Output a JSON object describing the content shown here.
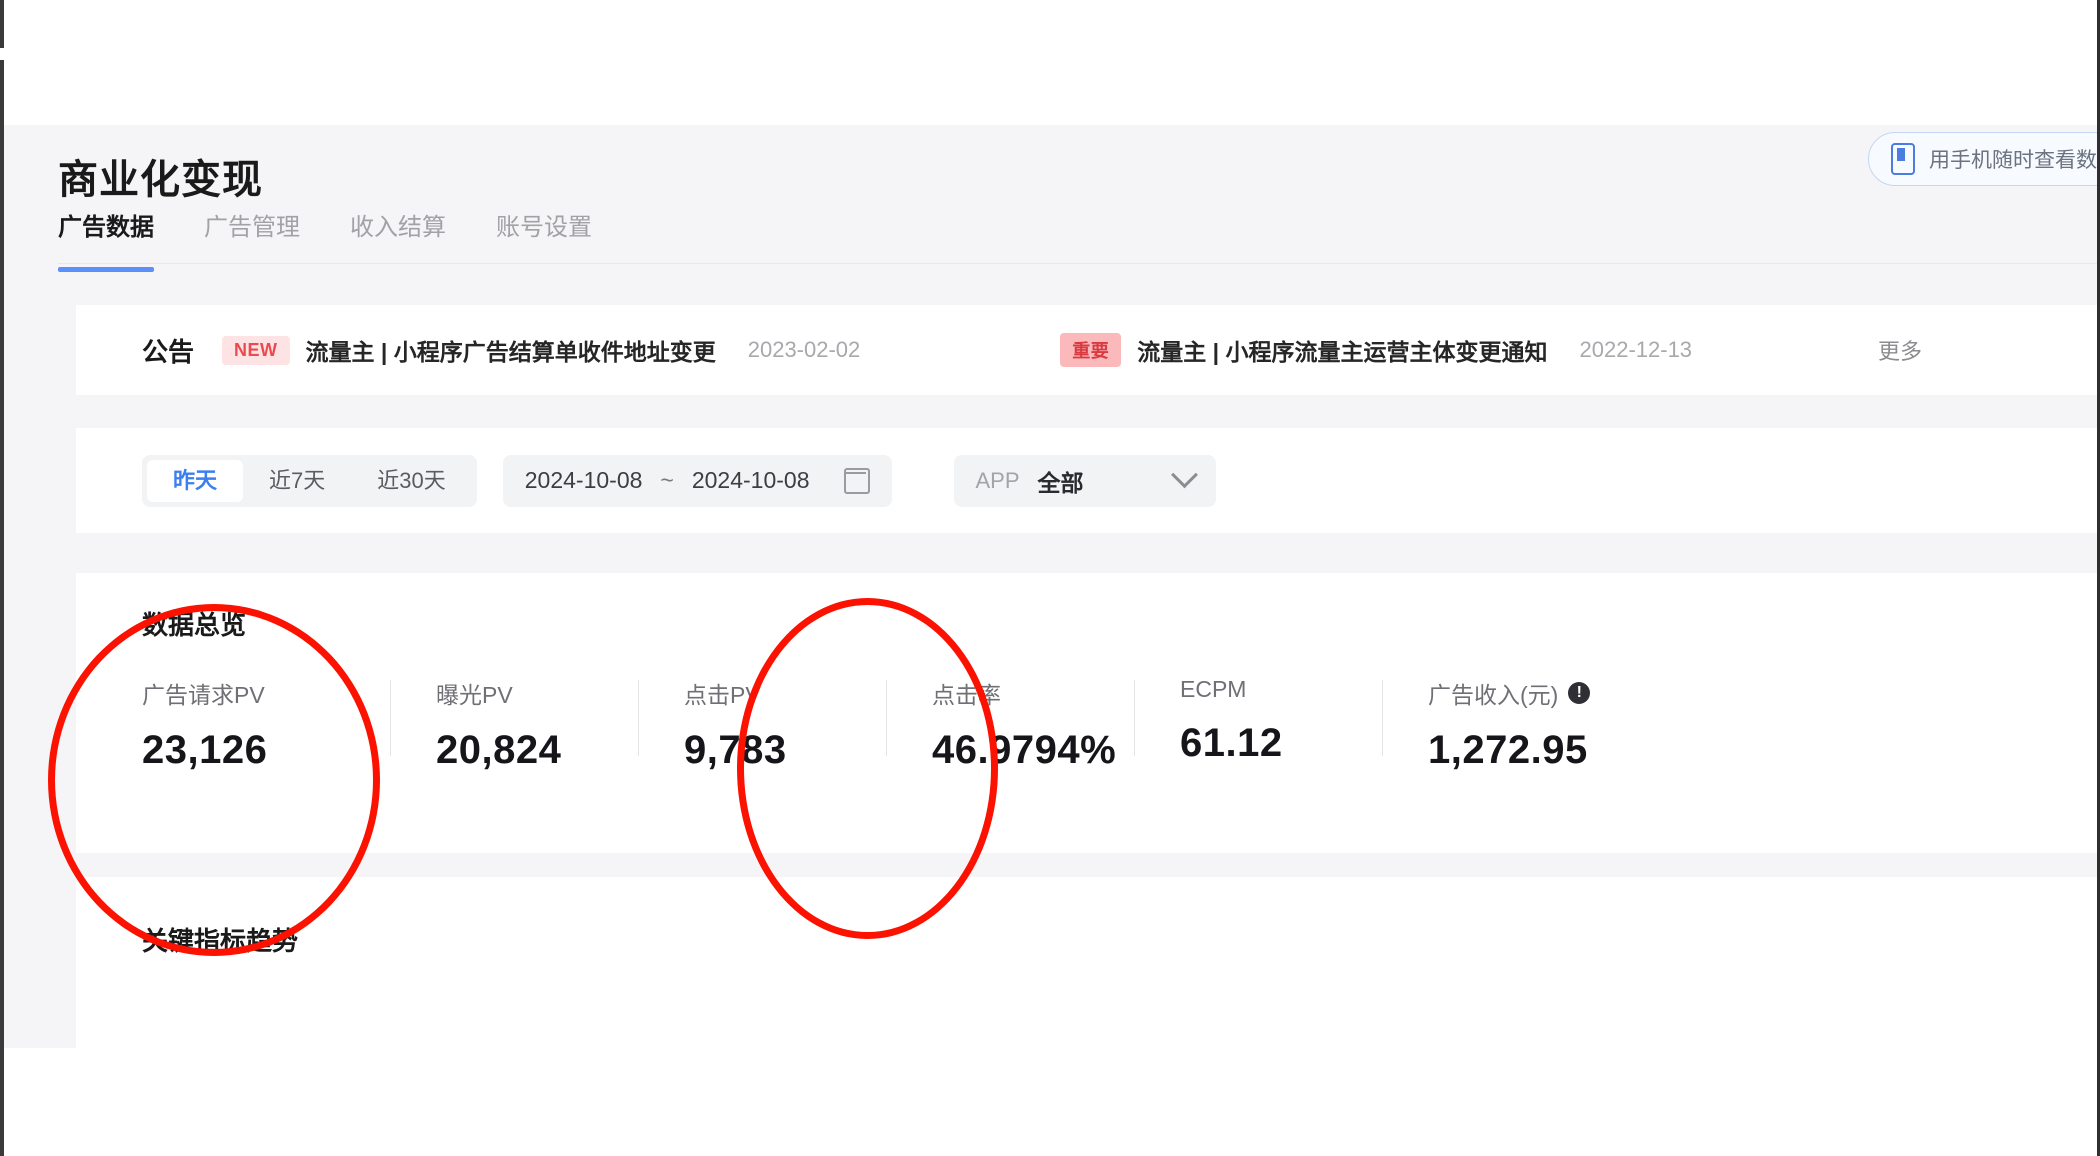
{
  "header": {
    "title": "商业化变现",
    "phone_button": {
      "label": "用手机随时查看数",
      "icon": "phone-icon"
    }
  },
  "tabs": [
    {
      "label": "广告数据",
      "active": true
    },
    {
      "label": "广告管理",
      "active": false
    },
    {
      "label": "收入结算",
      "active": false
    },
    {
      "label": "账号设置",
      "active": false
    }
  ],
  "announcement": {
    "title": "公告",
    "more_label": "更多",
    "items": [
      {
        "badge": "NEW",
        "badge_type": "new",
        "text": "流量主 | 小程序广告结算单收件地址变更",
        "date": "2023-02-02"
      },
      {
        "badge": "重要",
        "badge_type": "important",
        "text": "流量主 | 小程序流量主运营主体变更通知",
        "date": "2022-12-13"
      }
    ]
  },
  "filters": {
    "segments": [
      {
        "label": "昨天",
        "active": true
      },
      {
        "label": "近7天",
        "active": false
      },
      {
        "label": "近30天",
        "active": false
      }
    ],
    "date_range": {
      "start": "2024-10-08",
      "separator": "~",
      "end": "2024-10-08",
      "icon": "calendar-icon"
    },
    "app_select": {
      "label": "APP",
      "value": "全部",
      "icon": "chevron-down-icon"
    }
  },
  "overview": {
    "title": "数据总览",
    "metrics": [
      {
        "label": "广告请求PV",
        "value": "23,126",
        "has_info": false
      },
      {
        "label": "曝光PV",
        "value": "20,824",
        "has_info": false
      },
      {
        "label": "点击PV",
        "value": "9,783",
        "has_info": false
      },
      {
        "label": "点击率",
        "value": "46.9794%",
        "has_info": false
      },
      {
        "label": "ECPM",
        "value": "61.12",
        "has_info": false
      },
      {
        "label": "广告收入(元)",
        "value": "1,272.95",
        "has_info": true,
        "info_glyph": "!"
      }
    ]
  },
  "trend": {
    "title": "关键指标趋势"
  },
  "annotations": {
    "color": "#fb1200",
    "ellipses": [
      {
        "target": "广告请求PV 23,126"
      },
      {
        "target": "点击PV 9,783"
      }
    ]
  }
}
